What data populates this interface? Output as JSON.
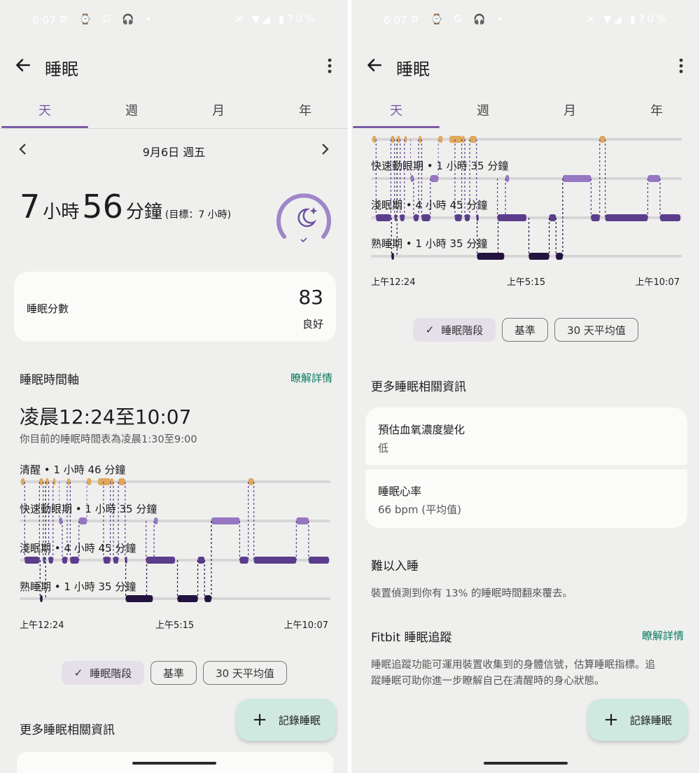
{
  "status": {
    "time": "6:07",
    "left_icons": "⚙ ⌚ G 🎧 •",
    "battery": "70%"
  },
  "app": {
    "title": "睡眠"
  },
  "tabs": [
    "天",
    "週",
    "月",
    "年"
  ],
  "date": {
    "label": "9月6日 週五"
  },
  "summary": {
    "hours": "7",
    "hours_unit": "小時",
    "minutes": "56",
    "minutes_unit": "分鐘",
    "goal": "(目標：7 小時)"
  },
  "score": {
    "label": "睡眠分數",
    "value": "83",
    "rating": "良好"
  },
  "timeline": {
    "title": "睡眠時間軸",
    "link": "瞭解詳情",
    "range": "凌晨12:24至10:07",
    "schedule": "你目前的睡眠時間表為凌晨1:30至9:00",
    "stages": [
      "清醒 • 1 小時 46 分鐘",
      "快速動眼期 • 1 小時 35 分鐘",
      "淺眠期 • 4 小時 45 分鐘",
      "熟睡期 • 1 小時 35 分鐘"
    ],
    "right_stages": [
      "快速動眼期 • 1 小時 35 分鐘",
      "淺眠期 • 4 小時 45 分鐘",
      "熟睡期 • 1 小時 35 分鐘"
    ],
    "axis": [
      "上午12:24",
      "上午5:15",
      "上午10:07"
    ]
  },
  "chips": {
    "stages": "睡眠階段",
    "baseline": "基準",
    "avg30": "30 天平均值"
  },
  "more_info": {
    "title": "更多睡眠相關資訊",
    "oxygen": {
      "label": "預估血氧濃度變化",
      "value": "低"
    },
    "heart": {
      "label": "睡眠心率",
      "value": "66 bpm (平均值)"
    }
  },
  "hard_to_sleep": {
    "title": "難以入睡",
    "text": "裝置偵測到你有 13% 的睡眠時間翻來覆去。"
  },
  "fitbit": {
    "title": "Fitbit 睡眠追蹤",
    "link": "瞭解詳情",
    "text1": "睡眠追蹤功能可運用裝置收集到的身體信號，估算睡眠指標。追",
    "text2": "蹤睡眠可助你進一步瞭解自己在清醒時的身心狀態。"
  },
  "fab": {
    "label": "記錄睡眠"
  },
  "chart_data": {
    "type": "hypnogram",
    "x_range": [
      "上午12:24",
      "上午10:07"
    ],
    "levels": [
      "清醒",
      "快速動眼期",
      "淺眠期",
      "熟睡期"
    ],
    "colors": {
      "awake": "#e0a85c",
      "rem": "#9577c2",
      "light": "#5b3d8c",
      "deep": "#24133f"
    },
    "segments": [
      {
        "stage": 0,
        "start": 0.0,
        "end": 0.012
      },
      {
        "stage": 2,
        "start": 0.012,
        "end": 0.06
      },
      {
        "stage": 0,
        "start": 0.06,
        "end": 0.072
      },
      {
        "stage": 2,
        "start": 0.072,
        "end": 0.078
      },
      {
        "stage": 3,
        "start": 0.062,
        "end": 0.07
      },
      {
        "stage": 0,
        "start": 0.08,
        "end": 0.09
      },
      {
        "stage": 2,
        "start": 0.09,
        "end": 0.104
      },
      {
        "stage": 0,
        "start": 0.104,
        "end": 0.112
      },
      {
        "stage": 1,
        "start": 0.124,
        "end": 0.134
      },
      {
        "stage": 2,
        "start": 0.134,
        "end": 0.15
      },
      {
        "stage": 0,
        "start": 0.15,
        "end": 0.16
      },
      {
        "stage": 2,
        "start": 0.16,
        "end": 0.188
      },
      {
        "stage": 1,
        "start": 0.188,
        "end": 0.214
      },
      {
        "stage": 0,
        "start": 0.214,
        "end": 0.228
      },
      {
        "stage": 0,
        "start": 0.25,
        "end": 0.29
      },
      {
        "stage": 2,
        "start": 0.268,
        "end": 0.29
      },
      {
        "stage": 0,
        "start": 0.29,
        "end": 0.3
      },
      {
        "stage": 2,
        "start": 0.3,
        "end": 0.316
      },
      {
        "stage": 0,
        "start": 0.316,
        "end": 0.338
      },
      {
        "stage": 2,
        "start": 0.338,
        "end": 0.34
      },
      {
        "stage": 3,
        "start": 0.34,
        "end": 0.428
      },
      {
        "stage": 2,
        "start": 0.408,
        "end": 0.434
      },
      {
        "stage": 1,
        "start": 0.432,
        "end": 0.444
      },
      {
        "stage": 2,
        "start": 0.406,
        "end": 0.5
      },
      {
        "stage": 3,
        "start": 0.508,
        "end": 0.574
      },
      {
        "stage": 2,
        "start": 0.574,
        "end": 0.596
      },
      {
        "stage": 3,
        "start": 0.596,
        "end": 0.618
      },
      {
        "stage": 1,
        "start": 0.618,
        "end": 0.71
      },
      {
        "stage": 2,
        "start": 0.71,
        "end": 0.738
      },
      {
        "stage": 0,
        "start": 0.738,
        "end": 0.756
      },
      {
        "stage": 2,
        "start": 0.756,
        "end": 0.894
      },
      {
        "stage": 1,
        "start": 0.894,
        "end": 0.934
      },
      {
        "stage": 2,
        "start": 0.934,
        "end": 1.0
      }
    ]
  }
}
